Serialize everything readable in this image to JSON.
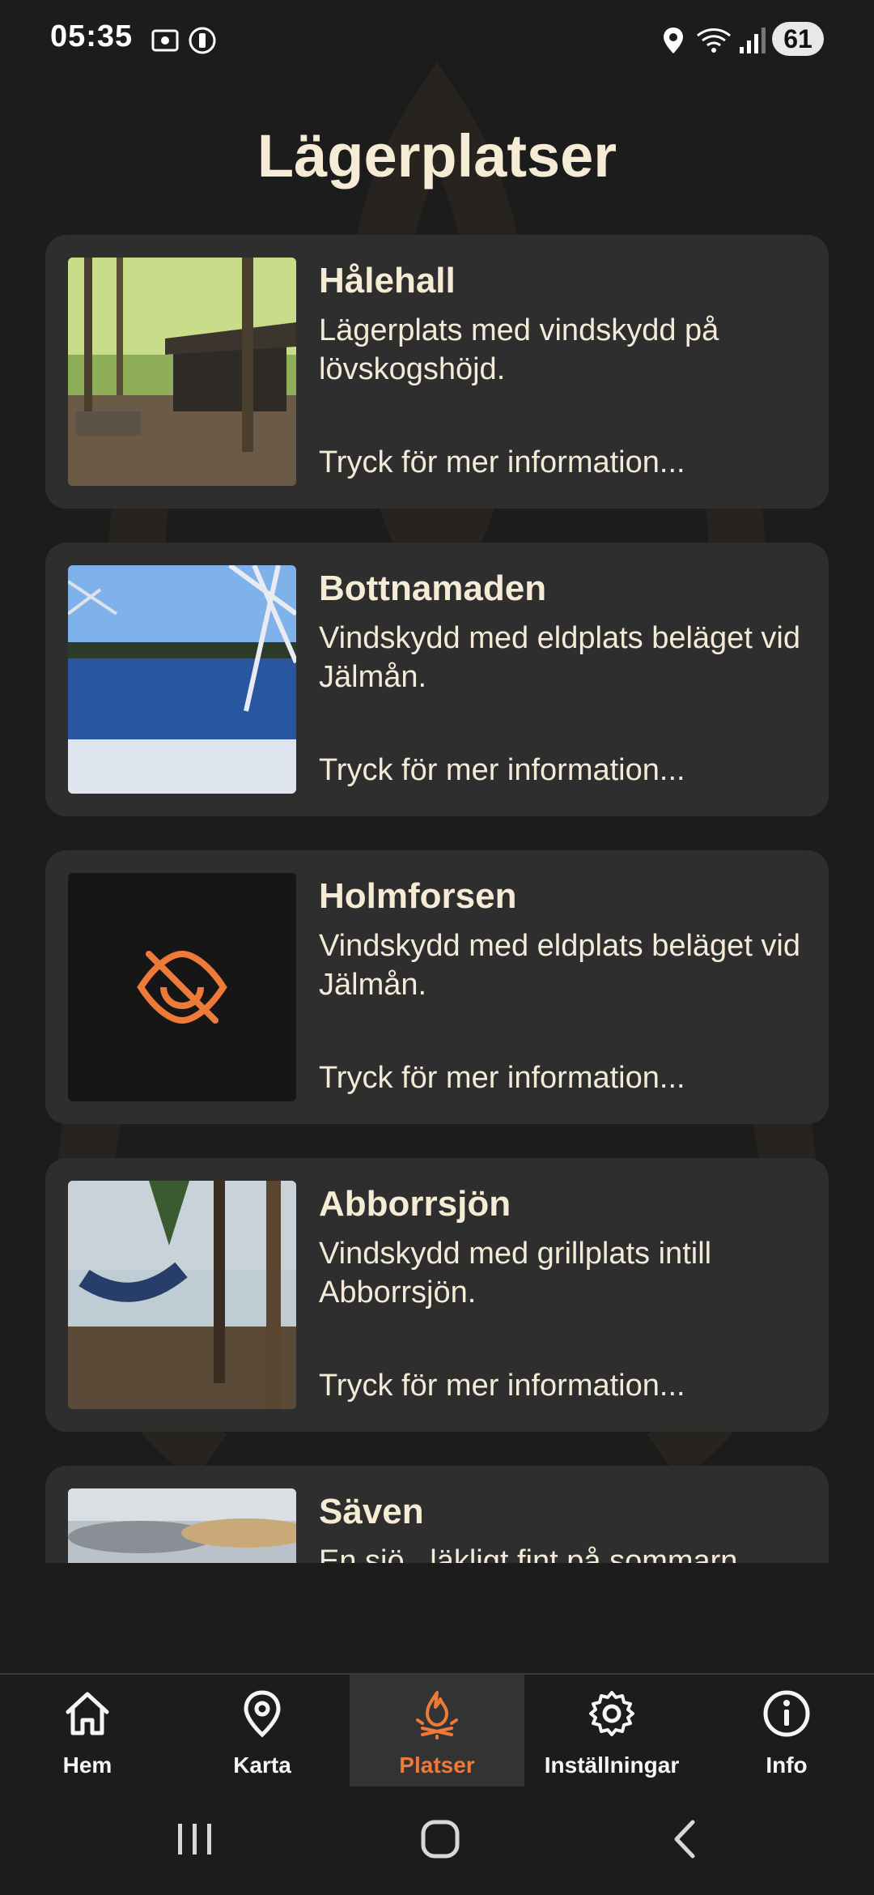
{
  "status_bar": {
    "time": "05:35",
    "battery": "61",
    "icons": [
      "screenshot-icon",
      "vpn-icon",
      "location-icon",
      "wifi-icon",
      "signal-icon"
    ]
  },
  "page": {
    "title": "Lägerplatser"
  },
  "accent_color": "#ee7a3a",
  "cards": [
    {
      "title": "Hålehall",
      "description": "Lägerplats med vindskydd på lövskogshöjd.",
      "more": "Tryck för mer information...",
      "image": "forest-shelter-photo"
    },
    {
      "title": "Bottnamaden",
      "description": "Vindskydd med eldplats beläget vid Jälmån.",
      "more": "Tryck för mer information...",
      "image": "frozen-river-photo"
    },
    {
      "title": "Holmforsen",
      "description": "Vindskydd med eldplats beläget vid Jälmån.",
      "more": "Tryck för mer information...",
      "image": "eye-off-icon"
    },
    {
      "title": "Abborrsjön",
      "description": "Vindskydd med grillplats intill Abborrsjön.",
      "more": "Tryck för mer information...",
      "image": "lake-hammock-photo"
    },
    {
      "title": "Säven",
      "description": "En sjö , läkligt fint på sommarn.",
      "more": "",
      "image": "sunset-sky-photo"
    }
  ],
  "bottom_nav": {
    "items": [
      {
        "label": "Hem",
        "icon": "home-icon",
        "active": false
      },
      {
        "label": "Karta",
        "icon": "map-pin-icon",
        "active": false
      },
      {
        "label": "Platser",
        "icon": "campfire-icon",
        "active": true
      },
      {
        "label": "Inställningar",
        "icon": "gear-icon",
        "active": false
      },
      {
        "label": "Info",
        "icon": "info-icon",
        "active": false
      }
    ]
  },
  "system_nav": [
    "recents-button",
    "home-button",
    "back-button"
  ]
}
